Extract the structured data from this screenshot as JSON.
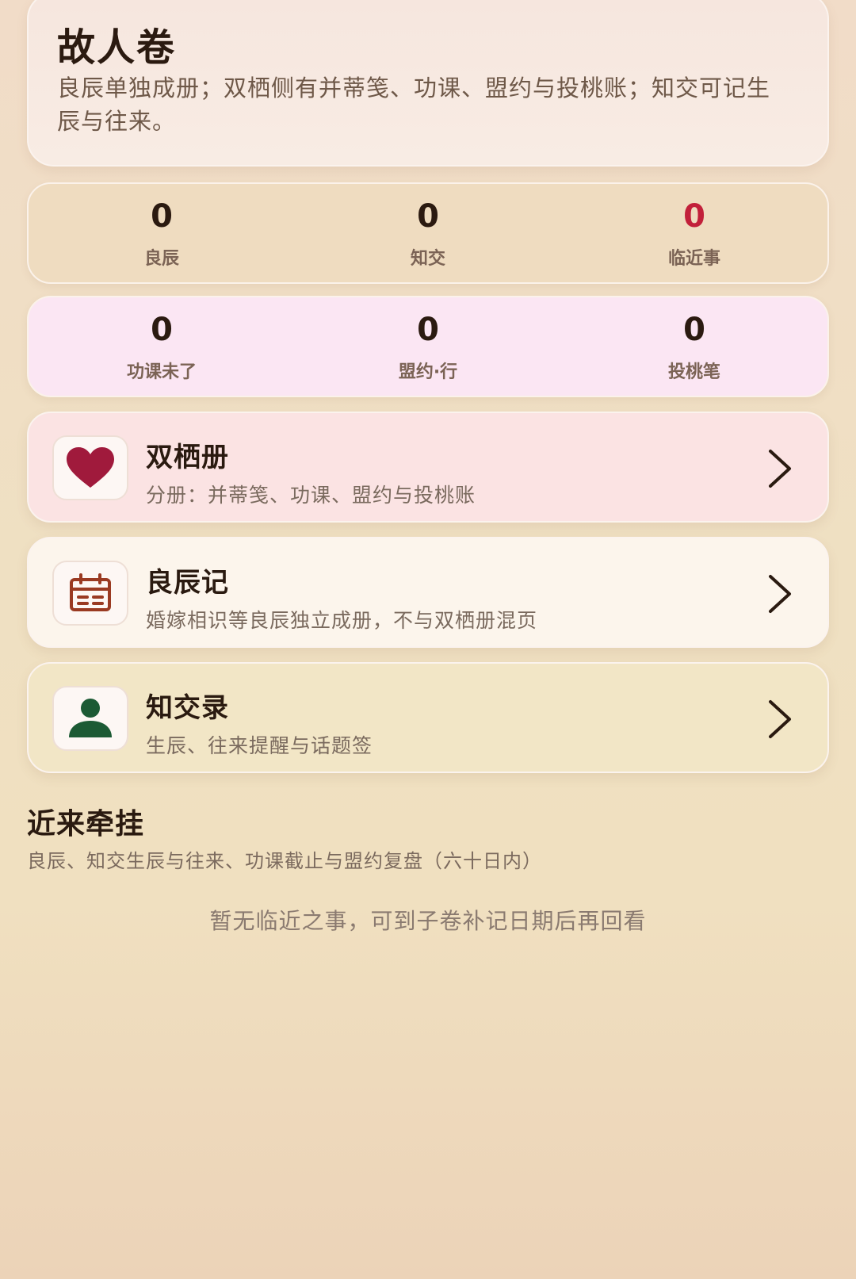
{
  "header": {
    "title": "故人卷",
    "description": "良辰单独成册；双栖侧有并蒂笺、功课、盟约与投桃账；知交可记生辰与往来。"
  },
  "stats_row_1": [
    {
      "value": "0",
      "label": "良辰"
    },
    {
      "value": "0",
      "label": "知交"
    },
    {
      "value": "0",
      "label": "临近事"
    }
  ],
  "stats_row_2": [
    {
      "value": "0",
      "label": "功课未了"
    },
    {
      "value": "0",
      "label": "盟约·行"
    },
    {
      "value": "0",
      "label": "投桃笔"
    }
  ],
  "nav_cards": [
    {
      "title": "双栖册",
      "subtitle": "分册：并蒂笺、功课、盟约与投桃账",
      "icon": "heart-icon"
    },
    {
      "title": "良辰记",
      "subtitle": "婚嫁相识等良辰独立成册，不与双栖册混页",
      "icon": "calendar-icon"
    },
    {
      "title": "知交录",
      "subtitle": "生辰、往来提醒与话题签",
      "icon": "person-icon"
    }
  ],
  "recent": {
    "title": "近来牵挂",
    "subtitle": "良辰、知交生辰与往来、功课截止与盟约复盘（六十日内）",
    "empty_text": "暂无临近之事，可到子卷补记日期后再回看"
  },
  "colors": {
    "alert": "#c2203a",
    "heart": "#a01a3c",
    "calendar": "#9a3a22",
    "person": "#1c5a34"
  }
}
